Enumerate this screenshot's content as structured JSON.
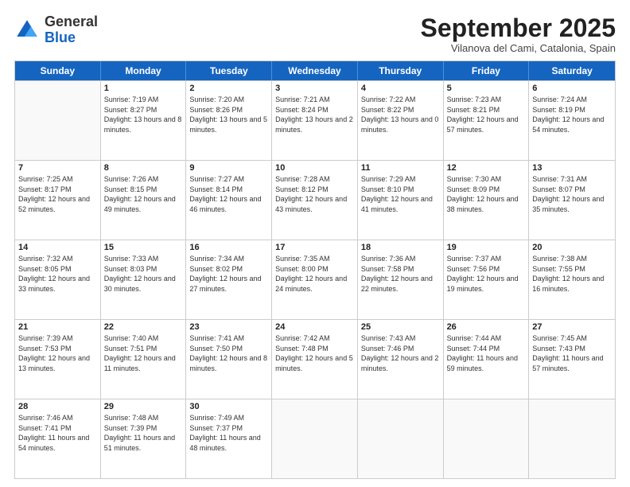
{
  "header": {
    "logo": {
      "general": "General",
      "blue": "Blue"
    },
    "month": "September 2025",
    "location": "Vilanova del Cami, Catalonia, Spain"
  },
  "weekdays": [
    "Sunday",
    "Monday",
    "Tuesday",
    "Wednesday",
    "Thursday",
    "Friday",
    "Saturday"
  ],
  "weeks": [
    [
      {
        "day": "",
        "sunrise": "",
        "sunset": "",
        "daylight": "",
        "empty": true
      },
      {
        "day": "1",
        "sunrise": "Sunrise: 7:19 AM",
        "sunset": "Sunset: 8:27 PM",
        "daylight": "Daylight: 13 hours and 8 minutes."
      },
      {
        "day": "2",
        "sunrise": "Sunrise: 7:20 AM",
        "sunset": "Sunset: 8:26 PM",
        "daylight": "Daylight: 13 hours and 5 minutes."
      },
      {
        "day": "3",
        "sunrise": "Sunrise: 7:21 AM",
        "sunset": "Sunset: 8:24 PM",
        "daylight": "Daylight: 13 hours and 2 minutes."
      },
      {
        "day": "4",
        "sunrise": "Sunrise: 7:22 AM",
        "sunset": "Sunset: 8:22 PM",
        "daylight": "Daylight: 13 hours and 0 minutes."
      },
      {
        "day": "5",
        "sunrise": "Sunrise: 7:23 AM",
        "sunset": "Sunset: 8:21 PM",
        "daylight": "Daylight: 12 hours and 57 minutes."
      },
      {
        "day": "6",
        "sunrise": "Sunrise: 7:24 AM",
        "sunset": "Sunset: 8:19 PM",
        "daylight": "Daylight: 12 hours and 54 minutes."
      }
    ],
    [
      {
        "day": "7",
        "sunrise": "Sunrise: 7:25 AM",
        "sunset": "Sunset: 8:17 PM",
        "daylight": "Daylight: 12 hours and 52 minutes."
      },
      {
        "day": "8",
        "sunrise": "Sunrise: 7:26 AM",
        "sunset": "Sunset: 8:15 PM",
        "daylight": "Daylight: 12 hours and 49 minutes."
      },
      {
        "day": "9",
        "sunrise": "Sunrise: 7:27 AM",
        "sunset": "Sunset: 8:14 PM",
        "daylight": "Daylight: 12 hours and 46 minutes."
      },
      {
        "day": "10",
        "sunrise": "Sunrise: 7:28 AM",
        "sunset": "Sunset: 8:12 PM",
        "daylight": "Daylight: 12 hours and 43 minutes."
      },
      {
        "day": "11",
        "sunrise": "Sunrise: 7:29 AM",
        "sunset": "Sunset: 8:10 PM",
        "daylight": "Daylight: 12 hours and 41 minutes."
      },
      {
        "day": "12",
        "sunrise": "Sunrise: 7:30 AM",
        "sunset": "Sunset: 8:09 PM",
        "daylight": "Daylight: 12 hours and 38 minutes."
      },
      {
        "day": "13",
        "sunrise": "Sunrise: 7:31 AM",
        "sunset": "Sunset: 8:07 PM",
        "daylight": "Daylight: 12 hours and 35 minutes."
      }
    ],
    [
      {
        "day": "14",
        "sunrise": "Sunrise: 7:32 AM",
        "sunset": "Sunset: 8:05 PM",
        "daylight": "Daylight: 12 hours and 33 minutes."
      },
      {
        "day": "15",
        "sunrise": "Sunrise: 7:33 AM",
        "sunset": "Sunset: 8:03 PM",
        "daylight": "Daylight: 12 hours and 30 minutes."
      },
      {
        "day": "16",
        "sunrise": "Sunrise: 7:34 AM",
        "sunset": "Sunset: 8:02 PM",
        "daylight": "Daylight: 12 hours and 27 minutes."
      },
      {
        "day": "17",
        "sunrise": "Sunrise: 7:35 AM",
        "sunset": "Sunset: 8:00 PM",
        "daylight": "Daylight: 12 hours and 24 minutes."
      },
      {
        "day": "18",
        "sunrise": "Sunrise: 7:36 AM",
        "sunset": "Sunset: 7:58 PM",
        "daylight": "Daylight: 12 hours and 22 minutes."
      },
      {
        "day": "19",
        "sunrise": "Sunrise: 7:37 AM",
        "sunset": "Sunset: 7:56 PM",
        "daylight": "Daylight: 12 hours and 19 minutes."
      },
      {
        "day": "20",
        "sunrise": "Sunrise: 7:38 AM",
        "sunset": "Sunset: 7:55 PM",
        "daylight": "Daylight: 12 hours and 16 minutes."
      }
    ],
    [
      {
        "day": "21",
        "sunrise": "Sunrise: 7:39 AM",
        "sunset": "Sunset: 7:53 PM",
        "daylight": "Daylight: 12 hours and 13 minutes."
      },
      {
        "day": "22",
        "sunrise": "Sunrise: 7:40 AM",
        "sunset": "Sunset: 7:51 PM",
        "daylight": "Daylight: 12 hours and 11 minutes."
      },
      {
        "day": "23",
        "sunrise": "Sunrise: 7:41 AM",
        "sunset": "Sunset: 7:50 PM",
        "daylight": "Daylight: 12 hours and 8 minutes."
      },
      {
        "day": "24",
        "sunrise": "Sunrise: 7:42 AM",
        "sunset": "Sunset: 7:48 PM",
        "daylight": "Daylight: 12 hours and 5 minutes."
      },
      {
        "day": "25",
        "sunrise": "Sunrise: 7:43 AM",
        "sunset": "Sunset: 7:46 PM",
        "daylight": "Daylight: 12 hours and 2 minutes."
      },
      {
        "day": "26",
        "sunrise": "Sunrise: 7:44 AM",
        "sunset": "Sunset: 7:44 PM",
        "daylight": "Daylight: 11 hours and 59 minutes."
      },
      {
        "day": "27",
        "sunrise": "Sunrise: 7:45 AM",
        "sunset": "Sunset: 7:43 PM",
        "daylight": "Daylight: 11 hours and 57 minutes."
      }
    ],
    [
      {
        "day": "28",
        "sunrise": "Sunrise: 7:46 AM",
        "sunset": "Sunset: 7:41 PM",
        "daylight": "Daylight: 11 hours and 54 minutes."
      },
      {
        "day": "29",
        "sunrise": "Sunrise: 7:48 AM",
        "sunset": "Sunset: 7:39 PM",
        "daylight": "Daylight: 11 hours and 51 minutes."
      },
      {
        "day": "30",
        "sunrise": "Sunrise: 7:49 AM",
        "sunset": "Sunset: 7:37 PM",
        "daylight": "Daylight: 11 hours and 48 minutes."
      },
      {
        "day": "",
        "sunrise": "",
        "sunset": "",
        "daylight": "",
        "empty": true
      },
      {
        "day": "",
        "sunrise": "",
        "sunset": "",
        "daylight": "",
        "empty": true
      },
      {
        "day": "",
        "sunrise": "",
        "sunset": "",
        "daylight": "",
        "empty": true
      },
      {
        "day": "",
        "sunrise": "",
        "sunset": "",
        "daylight": "",
        "empty": true
      }
    ]
  ]
}
